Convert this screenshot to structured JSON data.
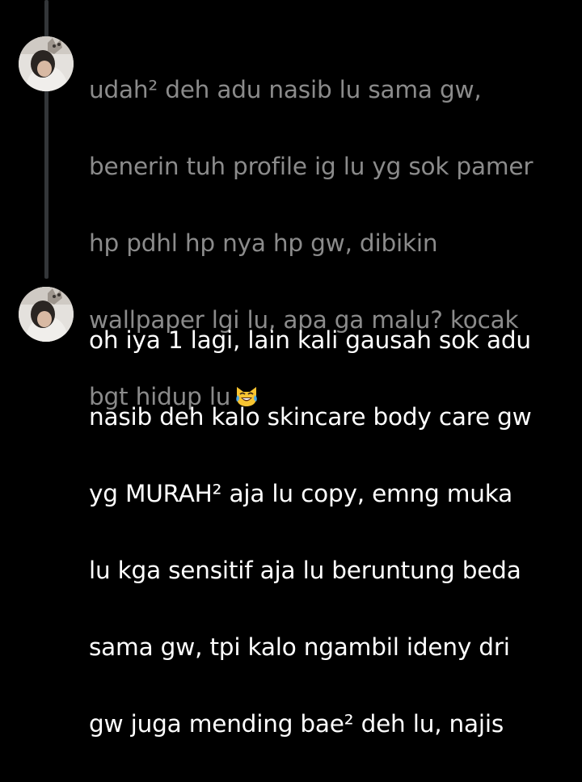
{
  "colors": {
    "background": "#000000",
    "thread_line": "#333639",
    "faded_text": "#8b8b8b",
    "bright_text": "#ffffff"
  },
  "posts": [
    {
      "avatar_icon": "user-avatar-photo",
      "lines": [
        "udah² deh adu nasib lu sama gw,",
        "benerin tuh profile ig lu yg sok pamer",
        "hp pdhl hp nya hp gw, dibikin",
        "wallpaper lgi lu, apa ga malu? kocak",
        "bgt hidup lu"
      ],
      "trailing_emoji": "cat-with-tears-of-joy-emoji"
    },
    {
      "avatar_icon": "user-avatar-photo",
      "lines": [
        "oh iya 1 lagi, lain kali gausah sok adu",
        "nasib deh kalo skincare body care gw",
        "yg MURAH² aja lu copy, emng muka",
        "lu kga sensitif aja lu beruntung beda",
        "sama gw, tpi kalo ngambil ideny dri",
        "gw juga mending bae² deh lu, najis"
      ]
    }
  ]
}
